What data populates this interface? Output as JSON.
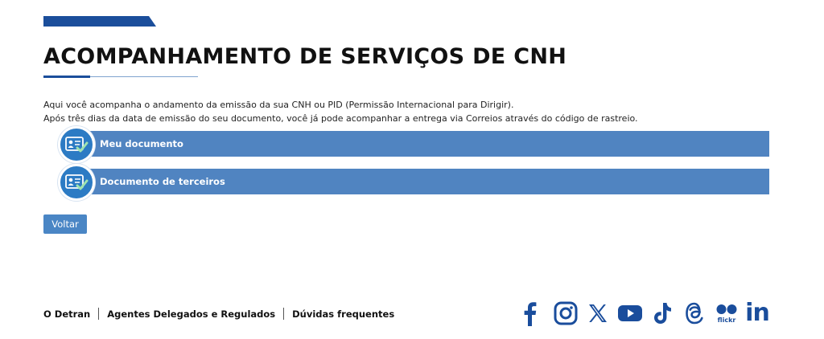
{
  "page": {
    "title": "ACOMPANHAMENTO DE SERVIÇOS DE CNH",
    "intro_line1": "Aqui você acompanha o andamento da emissão da sua CNH ou PID (Permissão Internacional para Dirigir).",
    "intro_line2": "Após três dias da data de emissão do seu documento, você já pode acompanhar a entrega via Correios através do código de rastreio."
  },
  "services": {
    "my_document": "Meu documento",
    "third_party": "Documento de terceiros"
  },
  "actions": {
    "back": "Voltar"
  },
  "footer": {
    "links": [
      "O Detran",
      "Agentes Delegados e Regulados",
      "Dúvidas frequentes"
    ],
    "social": {
      "flickr_label": "flickr",
      "linkedin_label": "in"
    }
  },
  "colors": {
    "brand_blue": "#1b4e9b",
    "service_bar": "#5084c1",
    "button": "#4a86c5",
    "social_icon": "#1a4d9c"
  }
}
